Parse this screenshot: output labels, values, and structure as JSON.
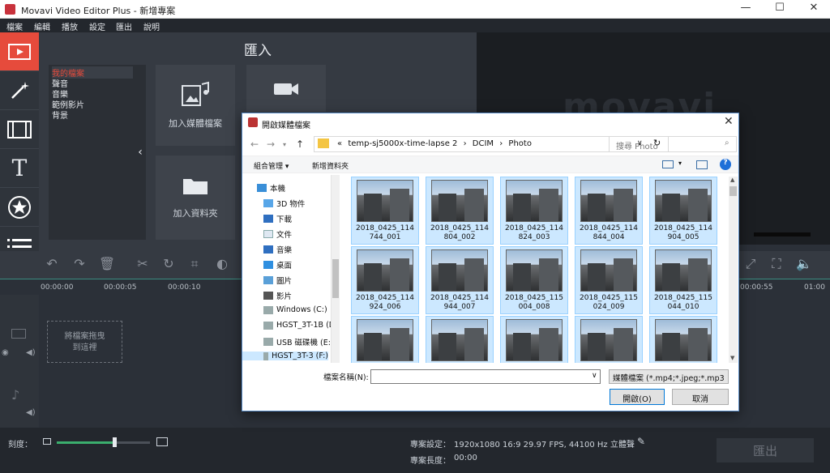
{
  "window": {
    "title": "Movavi Video Editor Plus - 新增專案",
    "controls": [
      "—",
      "☐",
      "✕"
    ]
  },
  "menu": [
    "檔案",
    "編輯",
    "播放",
    "設定",
    "匯出",
    "說明"
  ],
  "tools": [
    "import-icon",
    "magic-wand-icon",
    "filmstrip-icon",
    "text-icon",
    "star-icon",
    "list-icon"
  ],
  "import": {
    "header": "匯入",
    "categories": [
      "我的檔案",
      "聲音",
      "音樂",
      "範例影片",
      "背景"
    ],
    "tiles": [
      {
        "label": "加入媒體檔案"
      },
      {
        "label": "加入資料夾"
      }
    ]
  },
  "timeline": {
    "ticks": [
      "00:00:00",
      "00:00:05",
      "00:00:10",
      "00:00:55",
      "01:00"
    ],
    "drop_text_1": "將檔案拖曳",
    "drop_text_2": "到這裡"
  },
  "bottom": {
    "zoom_label": "刻度：",
    "zoom_value": 0.62,
    "settings_label": "專案設定：",
    "settings_value": "1920x1080 16:9 29.97 FPS, 44100 Hz 立體聲",
    "length_label": "專案長度：",
    "length_value": "00:00",
    "export_label": "匯出"
  },
  "dialog": {
    "title": "開啟媒體檔案",
    "path": [
      "«",
      "temp-sj5000x-time-lapse 2",
      "›",
      "DCIM",
      "›",
      "Photo"
    ],
    "search_placeholder": "搜尋 Photo",
    "organize": "組合管理 ▾",
    "new_folder": "新增資料夾",
    "nav": [
      {
        "label": "本機",
        "icon": "computer-icon"
      },
      {
        "label": "3D 物件",
        "icon": "cube-icon"
      },
      {
        "label": "下載",
        "icon": "download-icon"
      },
      {
        "label": "文件",
        "icon": "document-icon"
      },
      {
        "label": "音樂",
        "icon": "music-icon"
      },
      {
        "label": "桌面",
        "icon": "desktop-icon"
      },
      {
        "label": "圖片",
        "icon": "pictures-icon"
      },
      {
        "label": "影片",
        "icon": "video-icon"
      },
      {
        "label": "Windows (C:)",
        "icon": "drive-icon"
      },
      {
        "label": "HGST_3T-1B (D",
        "icon": "drive-icon"
      },
      {
        "label": "USB 磁碟機 (E:)",
        "icon": "usb-drive-icon"
      },
      {
        "label": "HGST_3T-3 (F:)",
        "icon": "drive-icon"
      }
    ],
    "files": [
      {
        "l1": "2018_0425_114",
        "l2": "744_001"
      },
      {
        "l1": "2018_0425_114",
        "l2": "804_002"
      },
      {
        "l1": "2018_0425_114",
        "l2": "824_003"
      },
      {
        "l1": "2018_0425_114",
        "l2": "844_004"
      },
      {
        "l1": "2018_0425_114",
        "l2": "904_005"
      },
      {
        "l1": "2018_0425_114",
        "l2": "924_006"
      },
      {
        "l1": "2018_0425_114",
        "l2": "944_007"
      },
      {
        "l1": "2018_0425_115",
        "l2": "004_008"
      },
      {
        "l1": "2018_0425_115",
        "l2": "024_009"
      },
      {
        "l1": "2018_0425_115",
        "l2": "044_010"
      },
      {
        "l1": "",
        "l2": ""
      },
      {
        "l1": "",
        "l2": ""
      },
      {
        "l1": "",
        "l2": ""
      },
      {
        "l1": "",
        "l2": ""
      },
      {
        "l1": "",
        "l2": ""
      }
    ],
    "filename_label": "檔案名稱(N):",
    "filename_value": "",
    "filetype": "媒體檔案 (*.mp4;*.jpeg;*.mp3",
    "open": "開啟(O)",
    "cancel": "取消"
  }
}
